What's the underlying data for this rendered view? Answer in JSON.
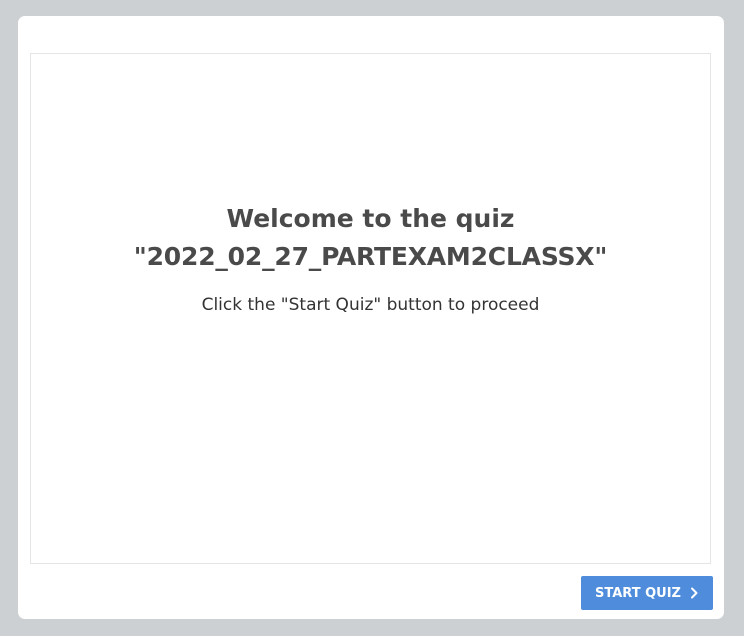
{
  "quiz": {
    "welcome_text": "Welcome to the quiz",
    "quiz_name": "\"2022_02_27_PARTEXAM2CLASSX\"",
    "instruction": "Click the \"Start Quiz\" button to proceed"
  },
  "footer": {
    "start_button_label": "START QUIZ",
    "start_button_icon": "chevron-right-icon",
    "button_color": "#4f8ddc"
  }
}
